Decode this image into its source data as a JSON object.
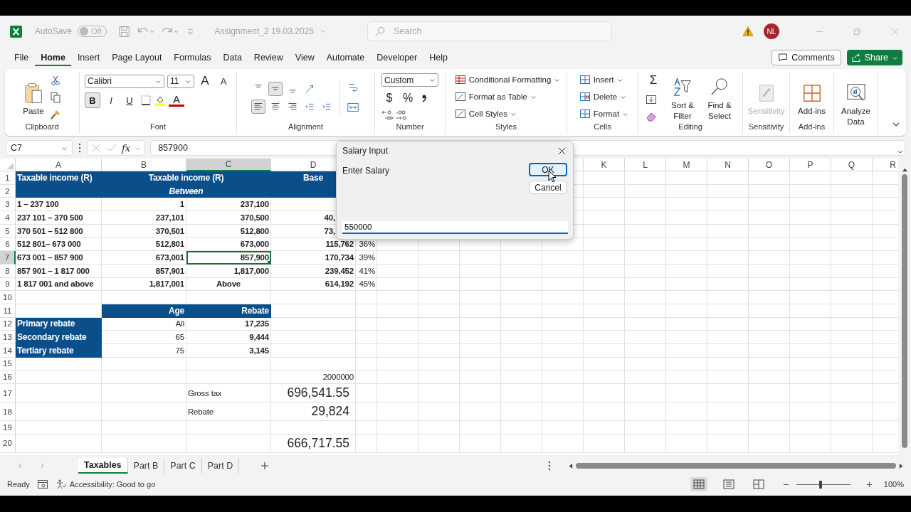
{
  "title_bar": {
    "autosave_label": "AutoSave",
    "autosave": {
      "label": "Off",
      "on": false
    },
    "document_title": "Assignment_2 19.03.2025",
    "search": {
      "placeholder": "Search"
    },
    "avatar": "NL"
  },
  "menu": {
    "tabs": [
      {
        "label": "File",
        "selected": false
      },
      {
        "label": "Home",
        "selected": true
      },
      {
        "label": "Insert",
        "selected": false
      },
      {
        "label": "Page Layout",
        "selected": false
      },
      {
        "label": "Formulas",
        "selected": false
      },
      {
        "label": "Data",
        "selected": false
      },
      {
        "label": "Review",
        "selected": false
      },
      {
        "label": "View",
        "selected": false
      },
      {
        "label": "Automate",
        "selected": false
      },
      {
        "label": "Developer",
        "selected": false
      },
      {
        "label": "Help",
        "selected": false
      }
    ],
    "comments": "Comments",
    "share": "Share"
  },
  "ribbon": {
    "clipboard": {
      "paste": "Paste",
      "label": "Clipboard"
    },
    "font": {
      "name": "Calibri",
      "size": "11",
      "grow": "A",
      "shrink": "A",
      "color_letter": "A",
      "styles": [
        {
          "label": "B",
          "selected": true
        },
        {
          "label": "I",
          "selected": false
        },
        {
          "label": "U",
          "selected": false
        }
      ],
      "label": "Font"
    },
    "alignment": {
      "vertical": [
        {
          "selected": false
        },
        {
          "selected": true
        },
        {
          "selected": false
        }
      ],
      "horizontal": [
        {
          "selected": true
        },
        {
          "selected": false
        },
        {
          "selected": false
        }
      ],
      "label": "Alignment"
    },
    "number": {
      "format": "Custom",
      "currency": "$",
      "percent": "%",
      "label": "Number"
    },
    "styles": {
      "items": [
        "Conditional Formatting",
        "Format as Table",
        "Cell Styles"
      ],
      "label": "Styles"
    },
    "cells": {
      "items": [
        "Insert",
        "Delete",
        "Format"
      ],
      "label": "Cells"
    },
    "editing": {
      "sum": "Σ",
      "buttons": [
        "Sort & Filter",
        "Find & Select"
      ],
      "label": "Editing"
    },
    "sensitivity": {
      "button": "Sensitivity",
      "disabled": true,
      "label": "Sensitivity"
    },
    "addins": {
      "button": "Add-ins",
      "label": "Add-ins"
    },
    "analyze": {
      "button": "Analyze Data"
    }
  },
  "formula_bar": {
    "name_box": "C7",
    "function_label": "fx",
    "formula": "857900"
  },
  "columns": {
    "left": [
      {
        "label": "A",
        "selected": false
      },
      {
        "label": "B",
        "selected": false
      },
      {
        "label": "C",
        "selected": true
      },
      {
        "label": "D",
        "selected": false
      }
    ],
    "right": [
      {
        "label": "K",
        "selected": false
      },
      {
        "label": "L",
        "selected": false
      },
      {
        "label": "M",
        "selected": false
      },
      {
        "label": "N",
        "selected": false
      },
      {
        "label": "O",
        "selected": false
      },
      {
        "label": "P",
        "selected": false
      },
      {
        "label": "Q",
        "selected": false
      },
      {
        "label": "R",
        "selected": false
      }
    ]
  },
  "rows": [
    {
      "number": "1",
      "selected": false,
      "cells": {
        "A": {
          "text": "Taxable income (R)",
          "kind": "band_label"
        },
        "B": {
          "text": "Taxable income (R)",
          "kind": "band_title",
          "merged": true
        },
        "D": {
          "text": "Base",
          "kind": "band_title"
        }
      }
    },
    {
      "number": "2",
      "selected": false,
      "cells": {
        "A": {
          "kind": "band"
        },
        "B": {
          "text": "Between",
          "kind": "band_subtitle",
          "merged": true
        },
        "D": {
          "kind": "band"
        }
      }
    },
    {
      "number": "3",
      "selected": false,
      "cells": {
        "A": {
          "text": "1 – 237 100",
          "kind": "bold_label"
        },
        "B": {
          "text": "1",
          "kind": "bold_number"
        },
        "C": {
          "text": "237,100",
          "kind": "bold_number"
        }
      }
    },
    {
      "number": "4",
      "selected": false,
      "cells": {
        "A": {
          "text": "237 101 – 370 500",
          "kind": "bold_label"
        },
        "B": {
          "text": "237,101",
          "kind": "bold_number"
        },
        "C": {
          "text": "370,500",
          "kind": "bold_number"
        },
        "D": {
          "text": "40,",
          "kind": "bold_number",
          "partial": true
        }
      }
    },
    {
      "number": "5",
      "selected": false,
      "cells": {
        "A": {
          "text": "370 501 – 512 800",
          "kind": "bold_label"
        },
        "B": {
          "text": "370,501",
          "kind": "bold_number"
        },
        "C": {
          "text": "512,800",
          "kind": "bold_number"
        },
        "D": {
          "text": "73,",
          "kind": "bold_number",
          "partial": true
        }
      }
    },
    {
      "number": "6",
      "selected": false,
      "cells": {
        "A": {
          "text": "512 801– 673 000",
          "kind": "bold_label"
        },
        "B": {
          "text": "512,801",
          "kind": "bold_number"
        },
        "C": {
          "text": "673,000",
          "kind": "bold_number"
        },
        "D": {
          "text": "115,762",
          "kind": "bold_number"
        },
        "E": {
          "text": "36%",
          "kind": "number"
        }
      }
    },
    {
      "number": "7",
      "selected": true,
      "cells": {
        "A": {
          "text": "673 001 – 857 900",
          "kind": "bold_label"
        },
        "B": {
          "text": "673,001",
          "kind": "bold_number"
        },
        "C": {
          "text": "857,900",
          "kind": "bold_number"
        },
        "D": {
          "text": "170,734",
          "kind": "bold_number"
        },
        "E": {
          "text": "39%",
          "kind": "number"
        }
      }
    },
    {
      "number": "8",
      "selected": false,
      "cells": {
        "A": {
          "text": "857 901 – 1 817 000",
          "kind": "bold_label"
        },
        "B": {
          "text": "857,901",
          "kind": "bold_number"
        },
        "C": {
          "text": "1,817,000",
          "kind": "bold_number"
        },
        "D": {
          "text": "239,452",
          "kind": "bold_number"
        },
        "E": {
          "text": "41%",
          "kind": "number"
        }
      }
    },
    {
      "number": "9",
      "selected": false,
      "cells": {
        "A": {
          "text": "1 817 001 and above",
          "kind": "bold_label"
        },
        "B": {
          "text": "1,817,001",
          "kind": "bold_number"
        },
        "C": {
          "text": "Above",
          "kind": "bold_center"
        },
        "D": {
          "text": "614,192",
          "kind": "bold_number"
        },
        "E": {
          "text": "45%",
          "kind": "number"
        }
      }
    },
    {
      "number": "10",
      "selected": false,
      "cells": {}
    },
    {
      "number": "11",
      "selected": false,
      "cells": {
        "B": {
          "text": "Age",
          "kind": "band_heading"
        },
        "C": {
          "text": "Rebate",
          "kind": "band_heading"
        }
      }
    },
    {
      "number": "12",
      "selected": false,
      "cells": {
        "A": {
          "text": "Primary rebate",
          "kind": "band_label"
        },
        "B": {
          "text": "All",
          "kind": "number"
        },
        "C": {
          "text": "17,235",
          "kind": "bold_number"
        }
      }
    },
    {
      "number": "13",
      "selected": false,
      "cells": {
        "A": {
          "text": "Secondary rebate",
          "kind": "band_label"
        },
        "B": {
          "text": "65",
          "kind": "number"
        },
        "C": {
          "text": "9,444",
          "kind": "bold_number"
        }
      }
    },
    {
      "number": "14",
      "selected": false,
      "cells": {
        "A": {
          "text": "Tertiary rebate",
          "kind": "band_label"
        },
        "B": {
          "text": "75",
          "kind": "number"
        },
        "C": {
          "text": "3,145",
          "kind": "bold_number"
        }
      }
    },
    {
      "number": "15",
      "selected": false,
      "cells": {}
    },
    {
      "number": "16",
      "selected": false,
      "cells": {
        "D": {
          "text": "2000000",
          "kind": "number"
        }
      }
    },
    {
      "number": "17",
      "selected": false,
      "cells": {
        "C": {
          "text": "Gross tax",
          "kind": "label"
        },
        "D": {
          "text": "696,541.55",
          "kind": "total"
        }
      }
    },
    {
      "number": "18",
      "selected": false,
      "cells": {
        "C": {
          "text": "Rebate",
          "kind": "label"
        },
        "D": {
          "text": "29,824",
          "kind": "total"
        }
      }
    },
    {
      "number": "19",
      "selected": false,
      "cells": {}
    },
    {
      "number": "20",
      "selected": false,
      "cells": {
        "D": {
          "text": "666,717.55",
          "kind": "total"
        }
      }
    }
  ],
  "dialog": {
    "title": "Salary Input",
    "prompt": "Enter Salary",
    "ok": "OK",
    "cancel": "Cancel",
    "value": "550000"
  },
  "sheet_tabs": [
    {
      "label": "Taxables",
      "selected": true
    },
    {
      "label": "Part B",
      "selected": false
    },
    {
      "label": "Part C",
      "selected": false
    },
    {
      "label": "Part D",
      "selected": false
    }
  ],
  "status_bar": {
    "mode": "Ready",
    "accessibility": "Accessibility: Good to go",
    "views": [
      {
        "selected": true
      },
      {
        "selected": false
      },
      {
        "selected": false
      }
    ],
    "zoom": {
      "level": 0.45,
      "label": "100%"
    }
  }
}
